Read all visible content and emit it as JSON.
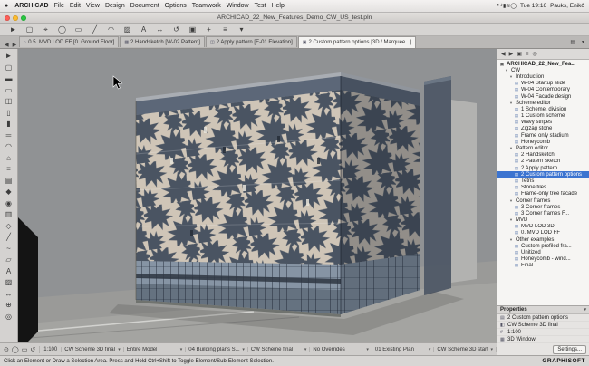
{
  "theme": {
    "sel": "#3c74d0",
    "facade": "#cfc5b7",
    "leaf": "#4a5462",
    "glass": "#8694a4",
    "band": "#5c6778",
    "vpbg": "#909294"
  },
  "menubar": {
    "apple": "●",
    "items": [
      {
        "label": "ARCHICAD",
        "bold": true,
        "name": "menu-archicad"
      },
      {
        "label": "File",
        "name": "menu-file"
      },
      {
        "label": "Edit",
        "name": "menu-edit"
      },
      {
        "label": "View",
        "name": "menu-view"
      },
      {
        "label": "Design",
        "name": "menu-design"
      },
      {
        "label": "Document",
        "name": "menu-document"
      },
      {
        "label": "Options",
        "name": "menu-options"
      },
      {
        "label": "Teamwork",
        "name": "menu-teamwork"
      },
      {
        "label": "Window",
        "name": "menu-window"
      },
      {
        "label": "Test",
        "name": "menu-test"
      },
      {
        "label": "Help",
        "name": "menu-help"
      }
    ],
    "status_icons": [
      {
        "glyph": "◐",
        "name": "display-icon"
      },
      {
        "glyph": "♪",
        "name": "volume-icon"
      },
      {
        "glyph": "▮",
        "name": "battery-icon"
      },
      {
        "glyph": "≋",
        "name": "wifi-icon"
      },
      {
        "glyph": "◯",
        "name": "spotlight-icon"
      }
    ],
    "time": "Tue 19:16",
    "user": "Pauks, Enikő"
  },
  "titlebar": {
    "title": "ARCHICAD_22_New_Features_Demo_CW_US_test.pln"
  },
  "toolbar": {
    "tools": [
      {
        "glyph": "►",
        "name": "arrow-tool-icon"
      },
      {
        "glyph": "▢",
        "name": "marquee-tool-icon"
      },
      {
        "glyph": "⌖",
        "name": "pick-tool-icon"
      },
      {
        "glyph": "◯",
        "name": "zoom-tool-icon"
      },
      {
        "glyph": "▭",
        "name": "wall-tool-icon"
      },
      {
        "glyph": "╱",
        "name": "line-tool-icon"
      },
      {
        "glyph": "◠",
        "name": "arc-tool-icon"
      },
      {
        "glyph": "▨",
        "name": "fill-tool-icon"
      },
      {
        "glyph": "A",
        "name": "text-tool-icon"
      },
      {
        "glyph": "↔",
        "name": "dimension-tool-icon"
      },
      {
        "glyph": "↺",
        "name": "rotate-tool-icon"
      },
      {
        "glyph": "▣",
        "name": "group-tool-icon"
      },
      {
        "glyph": "+",
        "name": "add-tool-icon"
      },
      {
        "glyph": "≡",
        "name": "layers-tool-icon"
      },
      {
        "glyph": "▾",
        "name": "more-tools-icon"
      }
    ]
  },
  "toolbox": {
    "tools": [
      {
        "glyph": "►",
        "name": "arrow-tool-icon"
      },
      {
        "glyph": "▢",
        "name": "marquee-tool-icon"
      },
      {
        "glyph": "▬",
        "name": "wall-tool-icon"
      },
      {
        "glyph": "▭",
        "name": "slab-tool-icon"
      },
      {
        "glyph": "◫",
        "name": "door-tool-icon"
      },
      {
        "glyph": "▯",
        "name": "window-tool-icon"
      },
      {
        "glyph": "▮",
        "name": "column-tool-icon"
      },
      {
        "glyph": "═",
        "name": "beam-tool-icon"
      },
      {
        "glyph": "◠",
        "name": "roof-tool-icon"
      },
      {
        "glyph": "⌂",
        "name": "shell-tool-icon"
      },
      {
        "glyph": "≡",
        "name": "stair-tool-icon"
      },
      {
        "glyph": "▤",
        "name": "mesh-tool-icon"
      },
      {
        "glyph": "◆",
        "name": "object-tool-icon"
      },
      {
        "glyph": "◉",
        "name": "lamp-tool-icon"
      },
      {
        "glyph": "▥",
        "name": "zone-tool-icon"
      },
      {
        "glyph": "◇",
        "name": "morph-tool-icon"
      },
      {
        "glyph": "╱",
        "name": "line-tool-icon"
      },
      {
        "glyph": "~",
        "name": "spline-tool-icon"
      },
      {
        "glyph": "▱",
        "name": "polygon-tool-icon"
      },
      {
        "glyph": "A",
        "name": "text-tool-icon"
      },
      {
        "glyph": "▨",
        "name": "fill-tool-icon"
      },
      {
        "glyph": "↔",
        "name": "dimension-tool-icon"
      },
      {
        "glyph": "⊕",
        "name": "camera-tool-icon"
      },
      {
        "glyph": "◎",
        "name": "section-tool-icon"
      }
    ]
  },
  "tabbar": {
    "left_icons": [
      {
        "glyph": "◀",
        "name": "tab-back-icon"
      },
      {
        "glyph": "▶",
        "name": "tab-forward-icon"
      }
    ],
    "tabs": [
      {
        "glyph": "⌂",
        "label": "0.5. MVD LOD FF [0. Ground Floor]",
        "name": "tab-ground-floor"
      },
      {
        "glyph": "▦",
        "label": "2 Handsketch [W-02 Pattern]",
        "name": "tab-handsketch"
      },
      {
        "glyph": "◫",
        "label": "2 Apply pattern [E-01 Elevation]",
        "name": "tab-apply-pattern"
      },
      {
        "glyph": "▣",
        "label": "2 Custom pattern options [3D / Marquee...]",
        "active": true,
        "name": "tab-custom-pattern-options"
      }
    ],
    "right_icons": [
      {
        "glyph": "▤",
        "name": "tab-list-icon"
      },
      {
        "glyph": "▾",
        "name": "tab-menu-icon"
      }
    ]
  },
  "navigator": {
    "header_icons": [
      {
        "glyph": "◀",
        "name": "nav-back-icon"
      },
      {
        "glyph": "▶",
        "name": "nav-forward-icon"
      },
      {
        "glyph": "▣",
        "name": "project-chooser-icon"
      },
      {
        "glyph": "≡",
        "name": "nav-list-icon"
      },
      {
        "glyph": "◎",
        "name": "nav-pin-icon"
      }
    ],
    "items": [
      {
        "glyph": "▣",
        "label": "ARCHICAD_22_New_Fea...",
        "level": 0,
        "type": "root"
      },
      {
        "glyph": "▾",
        "label": "CW",
        "level": 1,
        "type": "folder"
      },
      {
        "glyph": "▾",
        "label": "Introduction",
        "level": 2,
        "type": "folder"
      },
      {
        "glyph": "▤",
        "label": "W-04 Startup slide",
        "level": 3,
        "type": "item"
      },
      {
        "glyph": "▤",
        "label": "W-04 Contemporary",
        "level": 3,
        "type": "item"
      },
      {
        "glyph": "▤",
        "label": "W-04 Facade design",
        "level": 3,
        "type": "item"
      },
      {
        "glyph": "▾",
        "label": "Scheme editor",
        "level": 2,
        "type": "folder"
      },
      {
        "glyph": "▤",
        "label": "1 Scheme, division",
        "level": 3,
        "type": "item"
      },
      {
        "glyph": "▤",
        "label": "1 Custom scheme",
        "level": 3,
        "type": "item"
      },
      {
        "glyph": "▤",
        "label": "Wavy stripes",
        "level": 3,
        "type": "item"
      },
      {
        "glyph": "▤",
        "label": "Zigzag stone",
        "level": 3,
        "type": "item"
      },
      {
        "glyph": "▤",
        "label": "Frame only stadium",
        "level": 3,
        "type": "item"
      },
      {
        "glyph": "▤",
        "label": "Honeycomb",
        "level": 3,
        "type": "item"
      },
      {
        "glyph": "▾",
        "label": "Pattern editor",
        "level": 2,
        "type": "folder"
      },
      {
        "glyph": "▤",
        "label": "2 Handsketch",
        "level": 3,
        "type": "item"
      },
      {
        "glyph": "▤",
        "label": "2 Pattern sketch",
        "level": 3,
        "type": "item"
      },
      {
        "glyph": "▤",
        "label": "2 Apply pattern",
        "level": 3,
        "type": "item"
      },
      {
        "glyph": "▤",
        "label": "2 Custom pattern options",
        "level": 3,
        "type": "item",
        "selected": true
      },
      {
        "glyph": "▤",
        "label": "Tetris",
        "level": 3,
        "type": "item"
      },
      {
        "glyph": "▤",
        "label": "Stone tiles",
        "level": 3,
        "type": "item"
      },
      {
        "glyph": "▤",
        "label": "Frame-only tree facade",
        "level": 3,
        "type": "item"
      },
      {
        "glyph": "▾",
        "label": "Corner frames",
        "level": 2,
        "type": "folder"
      },
      {
        "glyph": "▤",
        "label": "3 Corner frames",
        "level": 3,
        "type": "item"
      },
      {
        "glyph": "▤",
        "label": "3 Corner frames F...",
        "level": 3,
        "type": "item"
      },
      {
        "glyph": "▾",
        "label": "MVD",
        "level": 2,
        "type": "folder"
      },
      {
        "glyph": "▤",
        "label": "MVD LOD 3D",
        "level": 3,
        "type": "item"
      },
      {
        "glyph": "▤",
        "label": "0. MVD LOD FF",
        "level": 3,
        "type": "item"
      },
      {
        "glyph": "▾",
        "label": "Other examples",
        "level": 2,
        "type": "folder"
      },
      {
        "glyph": "▤",
        "label": "Custom profiled fra...",
        "level": 3,
        "type": "item"
      },
      {
        "glyph": "▤",
        "label": "Unitized",
        "level": 3,
        "type": "item"
      },
      {
        "glyph": "▤",
        "label": "Honeycomb - wind...",
        "level": 3,
        "type": "item"
      },
      {
        "glyph": "▤",
        "label": "Final",
        "level": 3,
        "type": "item"
      }
    ]
  },
  "properties": {
    "title": "Properties",
    "rows": [
      {
        "glyph": "▤",
        "label": "2  Custom pattern options"
      },
      {
        "glyph": "◧",
        "label": "CW Scheme 3D final"
      },
      {
        "glyph": "#",
        "label": "1:100"
      },
      {
        "glyph": "▦",
        "label": "3D Window"
      }
    ],
    "settings_label": "Settings..."
  },
  "quickbar": {
    "icons": [
      {
        "glyph": "⊙",
        "name": "orbit-icon"
      },
      {
        "glyph": "◯",
        "name": "zoom-icon"
      },
      {
        "glyph": "▭",
        "name": "fit-view-icon"
      },
      {
        "glyph": "↺",
        "name": "previous-view-icon"
      }
    ],
    "zoom": "1:100",
    "dropdowns": [
      {
        "label": "CW Scheme 3D final",
        "name": "quick-options-view-settings"
      },
      {
        "label": "Entire Model",
        "name": "quick-options-filter"
      },
      {
        "label": "04 Building plans S...",
        "name": "quick-options-layer-combination"
      },
      {
        "label": "CW Scheme final",
        "name": "quick-options-pen-set"
      },
      {
        "label": "No Overrides",
        "name": "quick-options-graphic-override"
      },
      {
        "label": "01 Existing Plan",
        "name": "quick-options-renovation-filter"
      },
      {
        "label": "CW Scheme 3D start",
        "name": "quick-options-3d-style"
      }
    ]
  },
  "statusbar": {
    "hint": "Click an Element or Draw a Selection Area. Press and Hold Ctrl+Shift to Toggle Element/Sub-Element Selection.",
    "brand": "GRAPHISOFT"
  }
}
